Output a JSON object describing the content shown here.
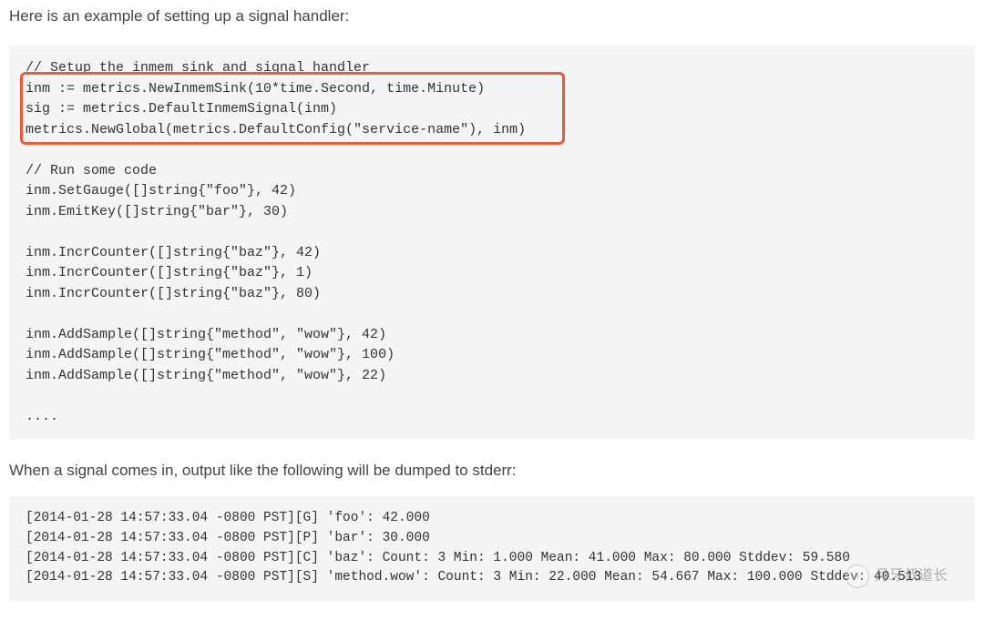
{
  "intro": "Here is an example of setting up a signal handler:",
  "code1": {
    "l01": "// Setup the inmem sink and signal handler",
    "l02": "inm := metrics.NewInmemSink(10*time.Second, time.Minute)",
    "l03": "sig := metrics.DefaultInmemSignal(inm)",
    "l04": "metrics.NewGlobal(metrics.DefaultConfig(\"service-name\"), inm)",
    "l05": "",
    "l06": "// Run some code",
    "l07": "inm.SetGauge([]string{\"foo\"}, 42)",
    "l08": "inm.EmitKey([]string{\"bar\"}, 30)",
    "l09": "",
    "l10": "inm.IncrCounter([]string{\"baz\"}, 42)",
    "l11": "inm.IncrCounter([]string{\"baz\"}, 1)",
    "l12": "inm.IncrCounter([]string{\"baz\"}, 80)",
    "l13": "",
    "l14": "inm.AddSample([]string{\"method\", \"wow\"}, 42)",
    "l15": "inm.AddSample([]string{\"method\", \"wow\"}, 100)",
    "l16": "inm.AddSample([]string{\"method\", \"wow\"}, 22)",
    "l17": "",
    "l18": "...."
  },
  "middle": "When a signal comes in, output like the following will be dumped to stderr:",
  "code2": {
    "l1": "[2014-01-28 14:57:33.04 -0800 PST][G] 'foo': 42.000",
    "l2": "[2014-01-28 14:57:33.04 -0800 PST][P] 'bar': 30.000",
    "l3": "[2014-01-28 14:57:33.04 -0800 PST][C] 'baz': Count: 3 Min: 1.000 Mean: 41.000 Max: 80.000 Stddev: 59.580",
    "l4": "[2014-01-28 14:57:33.04 -0800 PST][S] 'method.wow': Count: 3 Min: 22.000 Mean: 54.667 Max: 100.000 Stddev: 40.513"
  },
  "watermark": {
    "text": "月牙叔道长"
  }
}
